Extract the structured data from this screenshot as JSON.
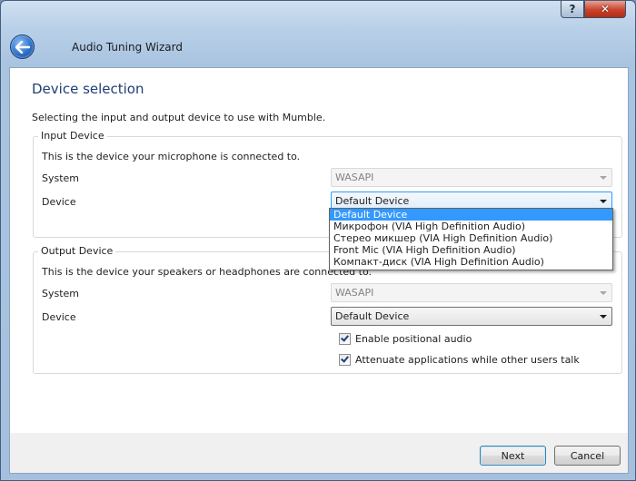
{
  "window": {
    "title": "Audio Tuning Wizard",
    "help_label": "?",
    "close_label": "✕"
  },
  "page": {
    "title": "Device selection",
    "description": "Selecting the input and output device to use with Mumble."
  },
  "input_device": {
    "legend": "Input Device",
    "description": "This is the device your microphone is connected to.",
    "system_label": "System",
    "system_value": "WASAPI",
    "device_label": "Device",
    "device_value": "Default Device",
    "options": [
      "Default Device",
      "Микрофон (VIA High Definition Audio)",
      "Стерео микшер (VIA High Definition Audio)",
      "Front Mic (VIA High Definition Audio)",
      "Компакт-диск (VIA High Definition Audio)"
    ]
  },
  "output_device": {
    "legend": "Output Device",
    "description": "This is the device your speakers or headphones are connected to.",
    "system_label": "System",
    "system_value": "WASAPI",
    "device_label": "Device",
    "device_value": "Default Device",
    "positional_audio_label": "Enable positional audio",
    "positional_audio_checked": true,
    "attenuate_label": "Attenuate applications while other users talk",
    "attenuate_checked": true
  },
  "footer": {
    "next_label": "Next",
    "cancel_label": "Cancel"
  },
  "colors": {
    "accent": "#3399ff",
    "title_blue": "#1f3e74"
  },
  "icons": {
    "back": "back-arrow-icon",
    "dropdown": "chevron-down-icon",
    "check": "checkmark-icon"
  }
}
